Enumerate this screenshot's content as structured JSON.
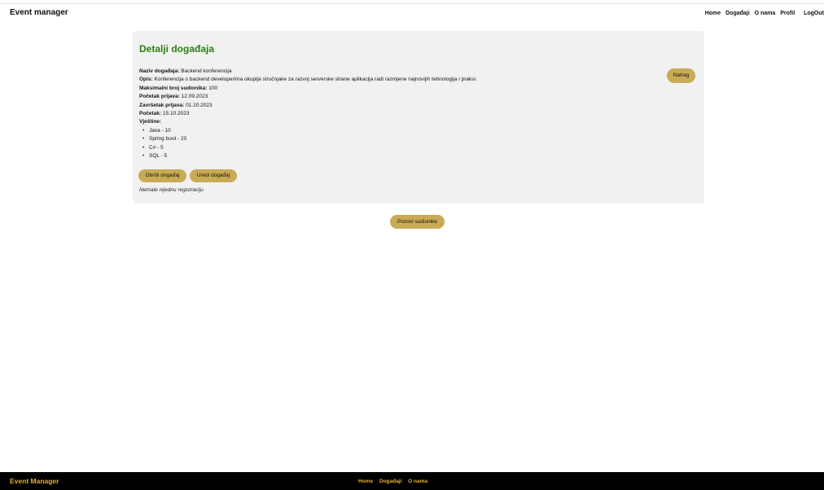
{
  "colors": {
    "title_green": "#2e7d12",
    "button_gold": "#c9aa55",
    "footer_bg": "#000000",
    "footer_text": "#e3b12f",
    "card_bg": "#f1f1f1"
  },
  "header": {
    "brand": "Event manager",
    "nav": [
      "Home",
      "Događaji",
      "O nama",
      "Profil",
      "LogOut"
    ]
  },
  "event": {
    "heading": "Detalji događaja",
    "back_button": "Natrag",
    "fields": [
      {
        "label": "Naziv događaja:",
        "value": "Backend konferencija"
      },
      {
        "label": "Opis:",
        "value": "Konferencija o backend developerima okuplja stručnjake za razvoj serverske strane aplikacija radi razmjene najnovijih tehnologija i praksi."
      },
      {
        "label": "Maksimalni broj sudionika:",
        "value": "100"
      },
      {
        "label": "Početak prijava:",
        "value": "12.09.2023"
      },
      {
        "label": "Završetak prijava:",
        "value": "01.10.2023"
      },
      {
        "label": "Početak:",
        "value": "15.10.2023"
      }
    ],
    "skills_label": "Vještine:",
    "skills": [
      "Java - 10",
      "Spring boot - 20",
      "C# - 5",
      "SQL - 5"
    ],
    "delete_button": "Obriši događaj",
    "edit_button": "Uredi događaj",
    "no_registrations": "Nemate nijednu registraciju"
  },
  "invite_button": "Pozovi sudionike",
  "footer": {
    "brand": "Event Manager",
    "nav": [
      "Home",
      "Događaji",
      "O nama"
    ]
  }
}
